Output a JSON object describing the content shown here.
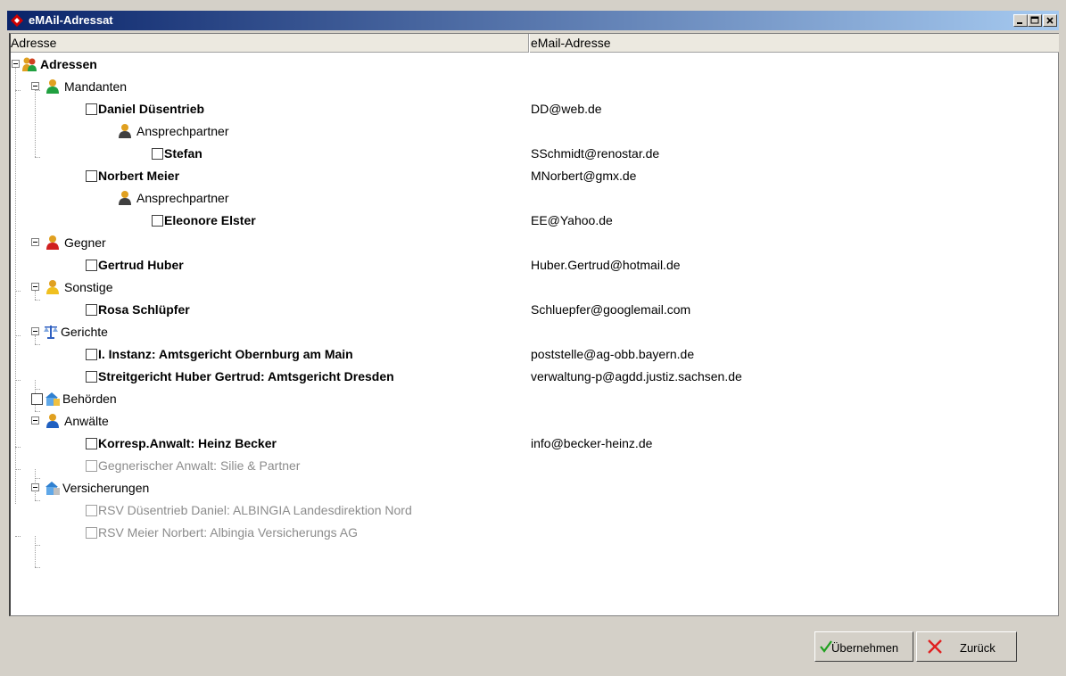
{
  "window": {
    "title": "eMAil-Adressat"
  },
  "columns": {
    "address": "Adresse",
    "email": "eMail-Adresse"
  },
  "tree": [
    {
      "label": "Adressen",
      "email": ""
    },
    {
      "label": "Mandanten",
      "email": ""
    },
    {
      "label": "Daniel Düsentrieb",
      "email": "DD@web.de"
    },
    {
      "label": "Ansprechpartner",
      "email": ""
    },
    {
      "label": "Stefan",
      "email": "SSchmidt@renostar.de"
    },
    {
      "label": "Norbert Meier",
      "email": "MNorbert@gmx.de"
    },
    {
      "label": "Ansprechpartner",
      "email": ""
    },
    {
      "label": "Eleonore Elster",
      "email": "EE@Yahoo.de"
    },
    {
      "label": "Gegner",
      "email": ""
    },
    {
      "label": "Gertrud Huber",
      "email": "Huber.Gertrud@hotmail.de"
    },
    {
      "label": "Sonstige",
      "email": ""
    },
    {
      "label": "Rosa Schlüpfer",
      "email": "Schluepfer@googlemail.com"
    },
    {
      "label": "Gerichte",
      "email": ""
    },
    {
      "label": "I. Instanz: Amtsgericht Obernburg am Main",
      "email": "poststelle@ag-obb.bayern.de"
    },
    {
      "label": "Streitgericht Huber Gertrud: Amtsgericht Dresden",
      "email": "verwaltung-p@agdd.justiz.sachsen.de"
    },
    {
      "label": "Behörden",
      "email": ""
    },
    {
      "label": "Anwälte",
      "email": ""
    },
    {
      "label": "Korresp.Anwalt: Heinz Becker",
      "email": "info@becker-heinz.de"
    },
    {
      "label": "Gegnerischer Anwalt: Silie & Partner",
      "email": ""
    },
    {
      "label": "Versicherungen",
      "email": ""
    },
    {
      "label": "RSV Düsentrieb Daniel: ALBINGIA Landesdirektion Nord",
      "email": ""
    },
    {
      "label": "RSV Meier Norbert: Albingia Versicherungs AG",
      "email": ""
    }
  ],
  "buttons": {
    "accept": "Übernehmen",
    "back": "Zurück"
  },
  "colors": {
    "title_start": "#0a246a",
    "title_end": "#a6caf0",
    "disabled_text": "#8c8c8c"
  },
  "icons": [
    "app-icon",
    "people-icon",
    "person-icon",
    "scales-icon",
    "building-icon",
    "checkmark-icon",
    "x-icon"
  ]
}
